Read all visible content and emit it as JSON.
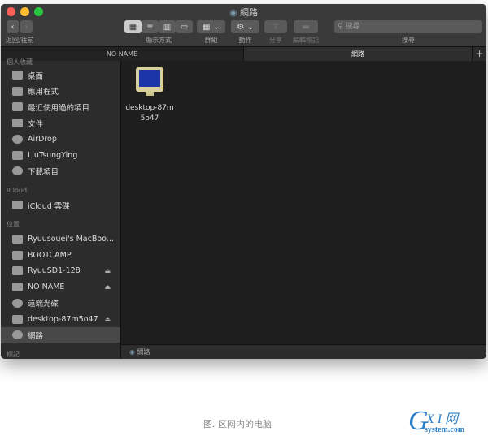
{
  "window": {
    "title": "網路",
    "colors": {
      "close": "#fe5f57",
      "minimize": "#febc2e",
      "zoom": "#28c840"
    }
  },
  "toolbar": {
    "back_forward_label": "返回/往前",
    "view_label": "顯示方式",
    "group_label": "群組",
    "action_label": "動作",
    "share_label": "分享",
    "tags_label": "編輯標記",
    "search_label": "搜尋",
    "search_placeholder": "搜尋"
  },
  "tabs": [
    {
      "label": "NO NAME",
      "active": false
    },
    {
      "label": "網路",
      "active": true
    }
  ],
  "sidebar": {
    "favorites_header": "個人收藏",
    "favorites": [
      {
        "label": "桌面",
        "icon": "desktop-icon"
      },
      {
        "label": "應用程式",
        "icon": "applications-icon"
      },
      {
        "label": "最近使用過的項目",
        "icon": "recents-icon"
      },
      {
        "label": "文件",
        "icon": "documents-icon"
      },
      {
        "label": "AirDrop",
        "icon": "airdrop-icon"
      },
      {
        "label": "LiuTsungYing",
        "icon": "home-icon"
      },
      {
        "label": "下載項目",
        "icon": "downloads-icon"
      }
    ],
    "icloud_header": "iCloud",
    "icloud": [
      {
        "label": "iCloud 雲碟",
        "icon": "cloud-icon"
      }
    ],
    "locations_header": "位置",
    "locations": [
      {
        "label": "Ryuusouei's MacBoo...",
        "icon": "laptop-icon"
      },
      {
        "label": "BOOTCAMP",
        "icon": "disk-icon"
      },
      {
        "label": "RyuuSD1-128",
        "icon": "disk-icon",
        "eject": true
      },
      {
        "label": "NO NAME",
        "icon": "disk-icon",
        "eject": true
      },
      {
        "label": "遠端光碟",
        "icon": "optical-disc-icon"
      },
      {
        "label": "desktop-87m5o47",
        "icon": "monitor-icon",
        "eject": true
      },
      {
        "label": "網路",
        "icon": "network-icon",
        "selected": true
      }
    ],
    "tags_header": "標記"
  },
  "main": {
    "items": [
      {
        "name": "desktop-87m5o47",
        "line1": "desktop-87m",
        "line2": "5o47"
      }
    ]
  },
  "statusbar": {
    "path": "網路"
  },
  "caption": "图. 区网内的电脑",
  "watermark": {
    "text": "GXI网",
    "sub": "system.com"
  }
}
